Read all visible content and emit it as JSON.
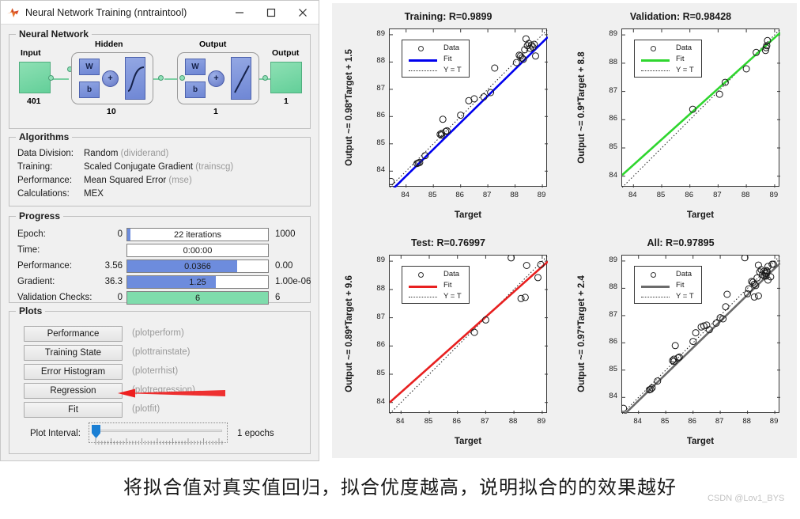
{
  "window": {
    "title": "Neural Network Training (nntraintool)",
    "icon": "matlab-logo-icon",
    "minimize_label": "—",
    "maximize_label": "□",
    "close_label": "✕"
  },
  "neural_network": {
    "panel_title": "Neural Network",
    "input_label": "Input",
    "input_size": "401",
    "hidden_label": "Hidden",
    "hidden_size": "10",
    "output_layer_label": "Output",
    "output_layer_size": "1",
    "output_label": "Output",
    "output_size": "1",
    "weight_label": "W",
    "bias_label": "b",
    "sum_label": "+"
  },
  "algorithms": {
    "panel_title": "Algorithms",
    "rows": [
      {
        "key": "Data Division:",
        "value": "Random",
        "fn": "(dividerand)"
      },
      {
        "key": "Training:",
        "value": "Scaled Conjugate Gradient",
        "fn": "(trainscg)"
      },
      {
        "key": "Performance:",
        "value": "Mean Squared Error",
        "fn": "(mse)"
      },
      {
        "key": "Calculations:",
        "value": "MEX",
        "fn": ""
      }
    ]
  },
  "progress": {
    "panel_title": "Progress",
    "rows": [
      {
        "label": "Epoch:",
        "left": "0",
        "bar": "22 iterations",
        "right": "1000",
        "percent": 2.2,
        "color": "#6d8cdd"
      },
      {
        "label": "Time:",
        "left": "",
        "bar": "0:00:00",
        "right": "",
        "percent": 0,
        "color": "#6d8cdd"
      },
      {
        "label": "Performance:",
        "left": "3.56",
        "bar": "0.0366",
        "right": "0.00",
        "percent": 78,
        "color": "#6d8cdd"
      },
      {
        "label": "Gradient:",
        "left": "36.3",
        "bar": "1.25",
        "right": "1.00e-06",
        "percent": 63,
        "color": "#6d8cdd"
      },
      {
        "label": "Validation Checks:",
        "left": "0",
        "bar": "6",
        "right": "6",
        "percent": 100,
        "color": "#7fdcac"
      }
    ]
  },
  "plots": {
    "panel_title": "Plots",
    "buttons": [
      {
        "label": "Performance",
        "fn": "(plotperform)"
      },
      {
        "label": "Training State",
        "fn": "(plottrainstate)"
      },
      {
        "label": "Error Histogram",
        "fn": "(ploterrhist)"
      },
      {
        "label": "Regression",
        "fn": "(plotregression)"
      },
      {
        "label": "Fit",
        "fn": "(plotfit)"
      }
    ],
    "interval_label": "Plot Interval:",
    "interval_value": "1 epochs",
    "annotation_color": "#ee1f1f"
  },
  "caption": {
    "text": "将拟合值对真实值回归，拟合优度越高，说明拟合的的效果越好",
    "watermark": "CSDN @Lov1_BYS"
  },
  "chart_data": [
    {
      "type": "scatter",
      "id": "training",
      "title": "Training: R=0.9899",
      "xlabel": "Target",
      "ylabel": "Output ~= 0.98*Target + 1.5",
      "xlim": [
        83.4,
        89.2
      ],
      "ylim": [
        83.4,
        89.2
      ],
      "xticks": [
        84,
        85,
        86,
        87,
        88,
        89
      ],
      "yticks": [
        84,
        85,
        86,
        87,
        88,
        89
      ],
      "grid": false,
      "legend": [
        "Data",
        "Fit",
        "Y = T"
      ],
      "legend_position": "upper-left",
      "fit_color": "#0000ee",
      "fit_slope": 0.98,
      "fit_intercept": 1.5,
      "points": [
        [
          83.45,
          83.62
        ],
        [
          84.4,
          84.28
        ],
        [
          84.45,
          84.3
        ],
        [
          84.5,
          84.32
        ],
        [
          84.7,
          84.57
        ],
        [
          85.25,
          85.35
        ],
        [
          85.3,
          85.32
        ],
        [
          85.3,
          85.38
        ],
        [
          85.35,
          85.9
        ],
        [
          85.45,
          85.45
        ],
        [
          85.5,
          85.48
        ],
        [
          86.0,
          86.05
        ],
        [
          86.3,
          86.58
        ],
        [
          86.5,
          86.65
        ],
        [
          86.85,
          86.72
        ],
        [
          87.1,
          86.88
        ],
        [
          87.25,
          87.78
        ],
        [
          88.05,
          87.98
        ],
        [
          88.15,
          88.25
        ],
        [
          88.2,
          88.22
        ],
        [
          88.25,
          88.15
        ],
        [
          88.3,
          88.1
        ],
        [
          88.35,
          88.45
        ],
        [
          88.4,
          88.85
        ],
        [
          88.45,
          88.6
        ],
        [
          88.5,
          88.68
        ],
        [
          88.55,
          88.5
        ],
        [
          88.6,
          88.62
        ],
        [
          88.65,
          88.55
        ],
        [
          88.7,
          88.65
        ],
        [
          88.75,
          88.22
        ]
      ]
    },
    {
      "type": "scatter",
      "id": "validation",
      "title": "Validation: R=0.98428",
      "xlabel": "Target",
      "ylabel": "Output ~= 0.9*Target + 8.8",
      "xlim": [
        83.6,
        89.2
      ],
      "ylim": [
        83.6,
        89.2
      ],
      "xticks": [
        84,
        85,
        86,
        87,
        88,
        89
      ],
      "yticks": [
        84,
        85,
        86,
        87,
        88,
        89
      ],
      "grid": false,
      "legend": [
        "Data",
        "Fit",
        "Y = T"
      ],
      "legend_position": "upper-left",
      "fit_color": "#2fd62f",
      "fit_slope": 0.9,
      "fit_intercept": 8.8,
      "points": [
        [
          86.1,
          86.37
        ],
        [
          87.05,
          86.9
        ],
        [
          87.25,
          87.32
        ],
        [
          88.0,
          87.8
        ],
        [
          88.35,
          88.38
        ],
        [
          88.68,
          88.45
        ],
        [
          88.7,
          88.55
        ],
        [
          88.72,
          88.62
        ],
        [
          88.75,
          88.8
        ]
      ]
    },
    {
      "type": "scatter",
      "id": "test",
      "title": "Test: R=0.76997",
      "xlabel": "Target",
      "ylabel": "Output ~= 0.89*Target + 9.6",
      "xlim": [
        83.6,
        89.2
      ],
      "ylim": [
        83.6,
        89.2
      ],
      "xticks": [
        84,
        85,
        86,
        87,
        88,
        89
      ],
      "yticks": [
        84,
        85,
        86,
        87,
        88,
        89
      ],
      "grid": false,
      "legend": [
        "Data",
        "Fit",
        "Y = T"
      ],
      "legend_position": "upper-left",
      "fit_color": "#e82020",
      "fit_slope": 0.89,
      "fit_intercept": 9.6,
      "points": [
        [
          86.6,
          86.48
        ],
        [
          87.0,
          86.92
        ],
        [
          87.9,
          89.12
        ],
        [
          88.25,
          87.68
        ],
        [
          88.4,
          87.72
        ],
        [
          88.45,
          88.85
        ],
        [
          88.85,
          88.42
        ],
        [
          88.95,
          88.88
        ]
      ]
    },
    {
      "type": "scatter",
      "id": "all",
      "title": "All: R=0.97895",
      "xlabel": "Target",
      "ylabel": "Output ~= 0.97*Target + 2.4",
      "xlim": [
        83.4,
        89.2
      ],
      "ylim": [
        83.4,
        89.2
      ],
      "xticks": [
        84,
        85,
        86,
        87,
        88,
        89
      ],
      "yticks": [
        84,
        85,
        86,
        87,
        88,
        89
      ],
      "grid": false,
      "legend": [
        "Data",
        "Fit",
        "Y = T"
      ],
      "legend_position": "upper-left",
      "fit_color": "#6b6b6b",
      "fit_slope": 0.97,
      "fit_intercept": 2.4,
      "points": [
        [
          83.45,
          83.6
        ],
        [
          84.4,
          84.28
        ],
        [
          84.45,
          84.3
        ],
        [
          84.5,
          84.35
        ],
        [
          84.7,
          84.6
        ],
        [
          85.25,
          85.35
        ],
        [
          85.3,
          85.32
        ],
        [
          85.3,
          85.4
        ],
        [
          85.35,
          85.9
        ],
        [
          85.45,
          85.45
        ],
        [
          85.5,
          85.48
        ],
        [
          86.0,
          86.05
        ],
        [
          86.1,
          86.37
        ],
        [
          86.3,
          86.58
        ],
        [
          86.4,
          86.62
        ],
        [
          86.5,
          86.65
        ],
        [
          86.6,
          86.48
        ],
        [
          86.85,
          86.72
        ],
        [
          87.0,
          86.92
        ],
        [
          87.1,
          86.88
        ],
        [
          87.2,
          87.32
        ],
        [
          87.25,
          87.78
        ],
        [
          87.9,
          89.12
        ],
        [
          88.0,
          87.8
        ],
        [
          88.05,
          87.98
        ],
        [
          88.15,
          88.25
        ],
        [
          88.2,
          88.22
        ],
        [
          88.25,
          88.15
        ],
        [
          88.25,
          87.68
        ],
        [
          88.3,
          88.1
        ],
        [
          88.35,
          88.38
        ],
        [
          88.4,
          87.72
        ],
        [
          88.4,
          88.85
        ],
        [
          88.45,
          88.6
        ],
        [
          88.5,
          88.68
        ],
        [
          88.55,
          88.5
        ],
        [
          88.6,
          88.62
        ],
        [
          88.62,
          88.45
        ],
        [
          88.65,
          88.55
        ],
        [
          88.68,
          88.45
        ],
        [
          88.7,
          88.65
        ],
        [
          88.7,
          88.55
        ],
        [
          88.72,
          88.62
        ],
        [
          88.75,
          88.8
        ],
        [
          88.75,
          88.3
        ],
        [
          88.85,
          88.42
        ],
        [
          88.9,
          88.88
        ],
        [
          88.95,
          88.88
        ]
      ]
    }
  ]
}
